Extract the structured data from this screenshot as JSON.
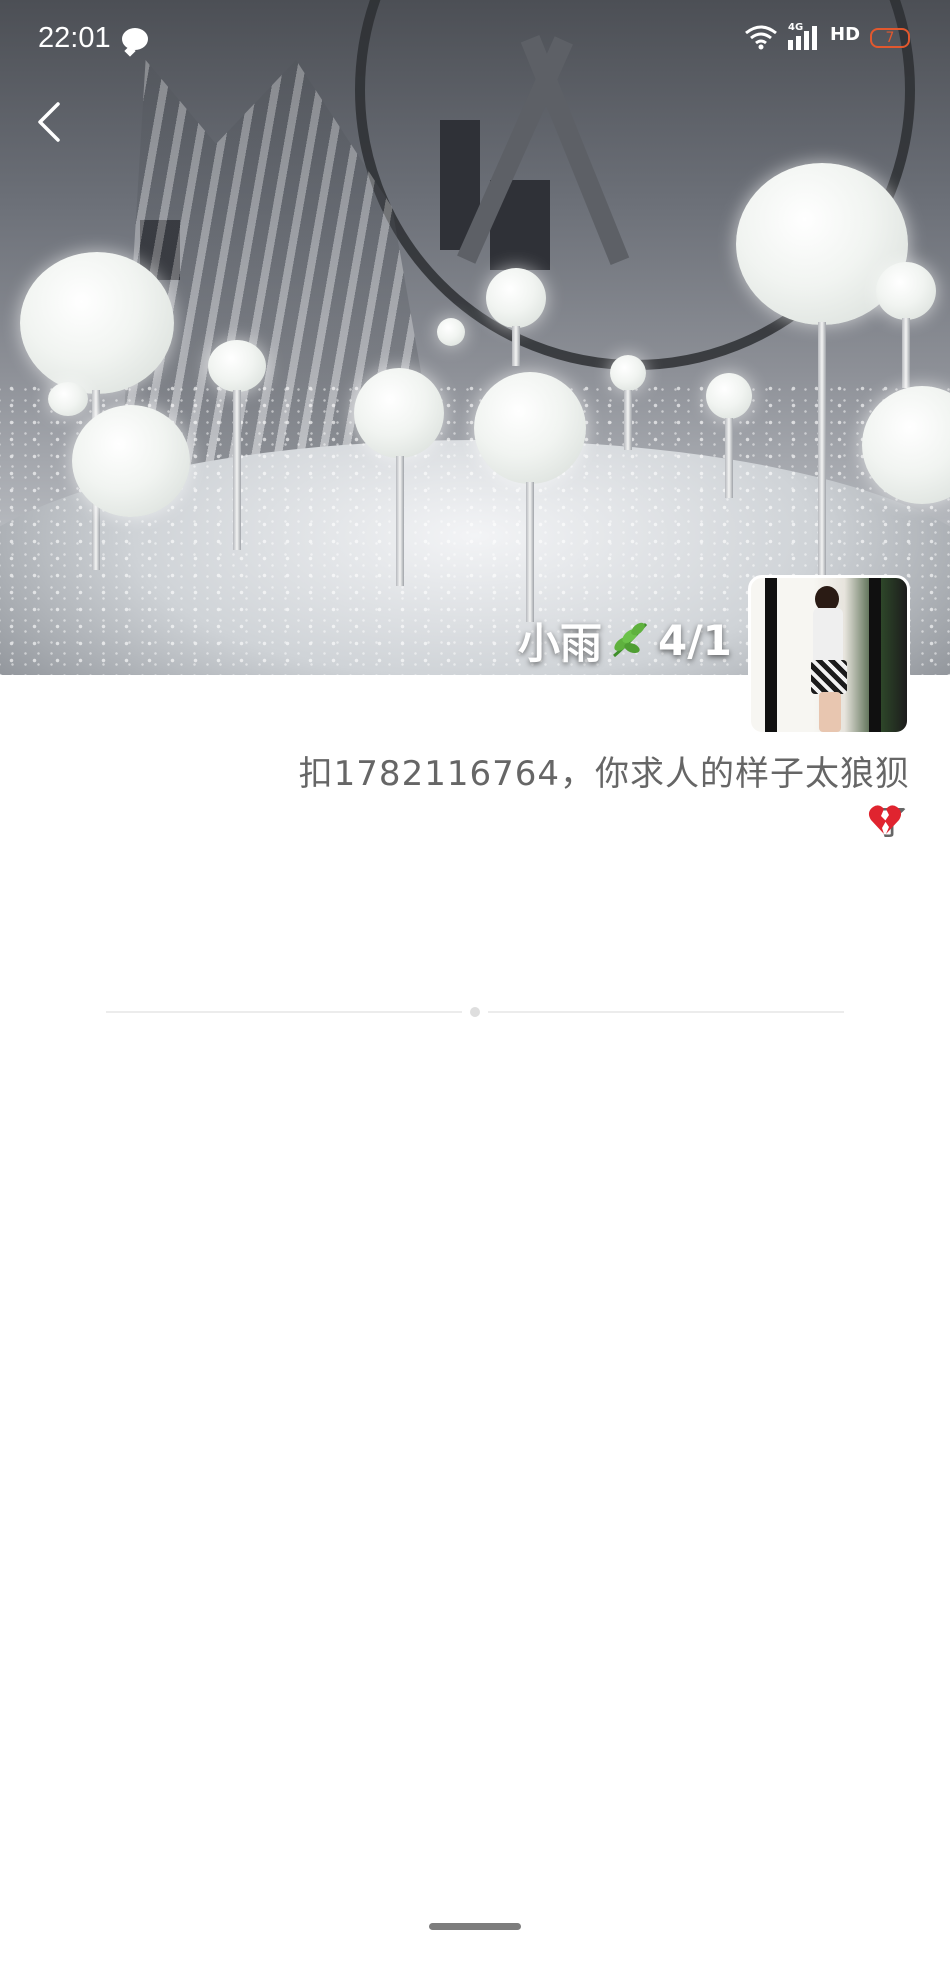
{
  "status_bar": {
    "time": "22:01",
    "network": "4G",
    "hd": "HD",
    "battery": "7"
  },
  "profile": {
    "name_line": "小雨",
    "name_suffix": "4/1",
    "signature": "扣1782116764，你求人的样子太狼狈了",
    "cover_photo": "ferris-wheel-night-lamps-photo",
    "avatar_photo": "woman-mirror-selfie-photo"
  },
  "icons": {
    "back": "chevron-left-icon",
    "leaf": "leaf-emoji-icon",
    "heart": "broken-heart-emoji-icon",
    "wechat": "chat-bubble-icon"
  },
  "colors": {
    "battery_low": "#e2582e",
    "signature_text": "#666666",
    "divider": "#ececec"
  }
}
